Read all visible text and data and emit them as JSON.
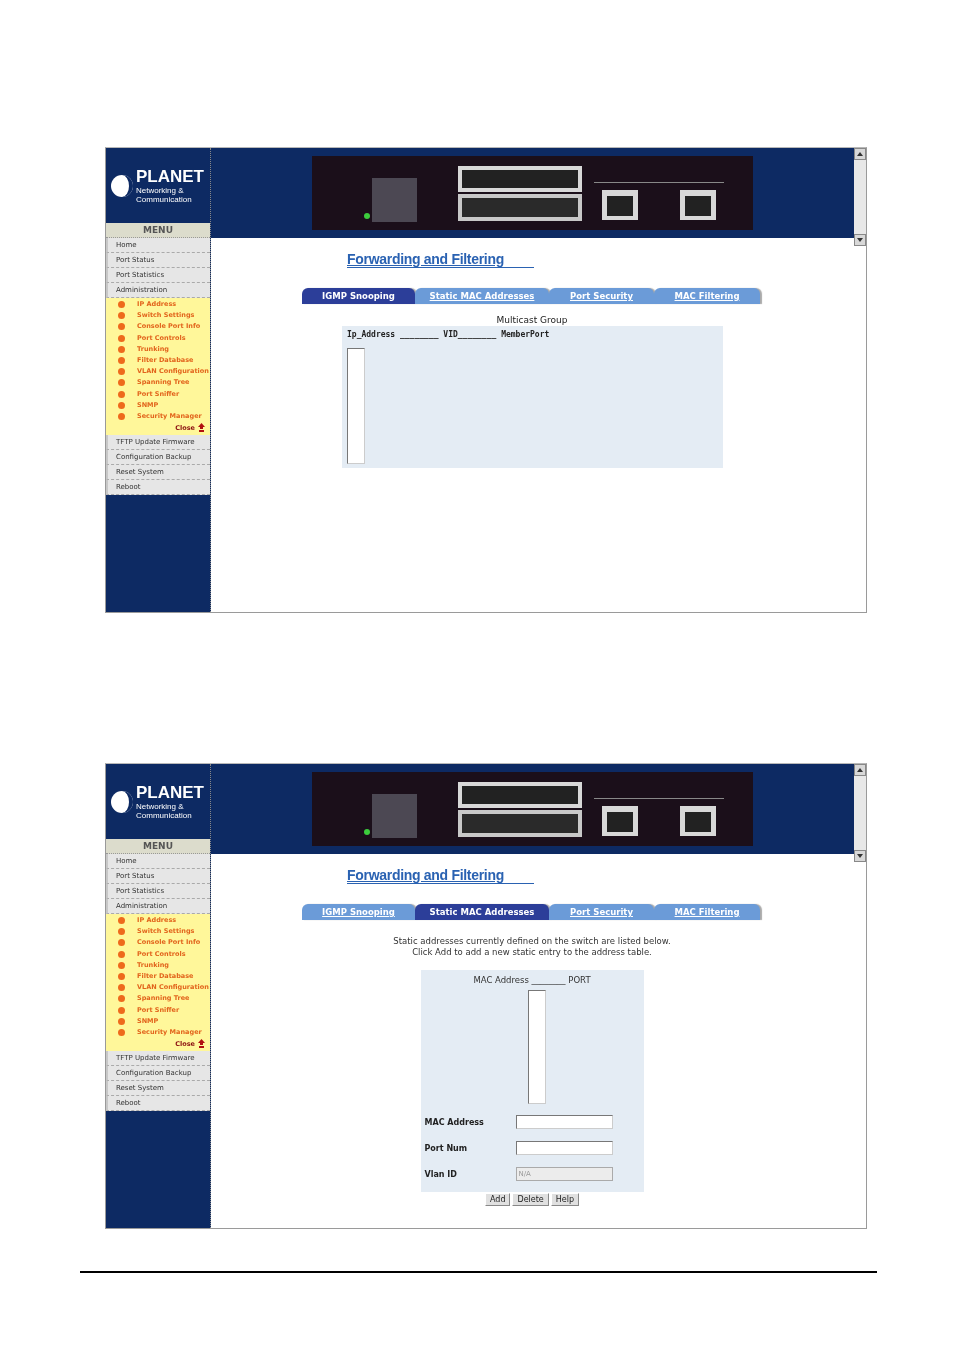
{
  "screens": [
    {
      "sidebar": {
        "logo": {
          "name": "PLANET",
          "tagline": "Networking & Communication"
        },
        "menu_title": "MENU",
        "items": [
          {
            "label": "Home"
          },
          {
            "label": "Port Status"
          },
          {
            "label": "Port Statistics"
          },
          {
            "label": "Administration",
            "expanded": true,
            "close_label": "Close",
            "children": [
              "IP Address",
              "Switch Settings",
              "Console Port Info",
              "Port Controls",
              "Trunking",
              "Filter Database",
              "VLAN Configuration",
              "Spanning Tree",
              "Port Sniffer",
              "SNMP",
              "Security Manager"
            ]
          },
          {
            "label": "TFTP Update Firmware"
          },
          {
            "label": "Configuration Backup"
          },
          {
            "label": "Reset System"
          },
          {
            "label": "Reboot"
          }
        ]
      },
      "title": "Forwarding and Filtering",
      "tabs": [
        {
          "label": "IGMP Snooping",
          "selected": true
        },
        {
          "label": "Static MAC Addresses",
          "selected": false
        },
        {
          "label": "Port Security",
          "selected": false
        },
        {
          "label": "MAC Filtering",
          "selected": false
        }
      ],
      "content": {
        "kind": "multicast",
        "caption": "Multicast Group",
        "header": "Ip_Address ________ VID________ MemberPort"
      }
    },
    {
      "sidebar": {
        "logo": {
          "name": "PLANET",
          "tagline": "Networking & Communication"
        },
        "menu_title": "MENU",
        "items": [
          {
            "label": "Home"
          },
          {
            "label": "Port Status"
          },
          {
            "label": "Port Statistics"
          },
          {
            "label": "Administration",
            "expanded": true,
            "close_label": "Close",
            "children": [
              "IP Address",
              "Switch Settings",
              "Console Port Info",
              "Port Controls",
              "Trunking",
              "Filter Database",
              "VLAN Configuration",
              "Spanning Tree",
              "Port Sniffer",
              "SNMP",
              "Security Manager"
            ]
          },
          {
            "label": "TFTP Update Firmware"
          },
          {
            "label": "Configuration Backup"
          },
          {
            "label": "Reset System"
          },
          {
            "label": "Reboot"
          }
        ]
      },
      "title": "Forwarding and Filtering",
      "tabs": [
        {
          "label": "IGMP Snooping",
          "selected": false
        },
        {
          "label": "Static MAC Addresses",
          "selected": true
        },
        {
          "label": "Port Security",
          "selected": false
        },
        {
          "label": "MAC Filtering",
          "selected": false
        }
      ],
      "content": {
        "kind": "static_mac",
        "description": [
          "Static addresses currently defined on the switch are listed below.",
          "Click Add to add a new static entry to the address table."
        ],
        "header": "MAC Address ________ PORT",
        "fields": [
          {
            "label": "MAC Address",
            "disabled": false
          },
          {
            "label": "Port Num",
            "disabled": false
          },
          {
            "label": "Vlan ID",
            "value": "N/A",
            "disabled": true
          }
        ],
        "buttons": [
          "Add",
          "Delete",
          "Help"
        ]
      }
    }
  ]
}
